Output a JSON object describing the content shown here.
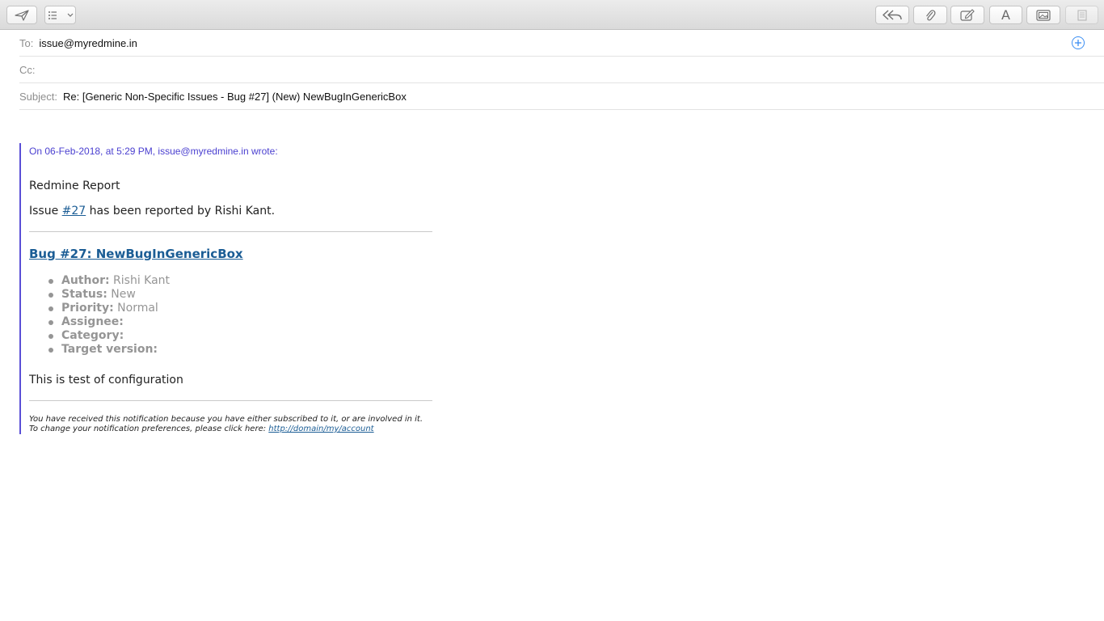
{
  "toolbar": {
    "left_buttons": [
      {
        "name": "send-button",
        "icon": "paper-plane-icon"
      },
      {
        "name": "header-fields-button",
        "icon": "list-icon"
      }
    ],
    "right_buttons": [
      {
        "name": "reply-all-button",
        "icon": "reply-all-icon"
      },
      {
        "name": "attach-button",
        "icon": "paperclip-icon"
      },
      {
        "name": "markup-button",
        "icon": "pen-square-icon"
      },
      {
        "name": "format-button",
        "icon": "font-icon",
        "glyph": "A"
      },
      {
        "name": "photo-browser-button",
        "icon": "photo-icon"
      },
      {
        "name": "stationery-button",
        "icon": "stationery-icon"
      }
    ]
  },
  "headers": {
    "to_label": "To:",
    "to_value": "issue@myredmine.in",
    "cc_label": "Cc:",
    "cc_value": "",
    "subject_label": "Subject:",
    "subject_value": "Re: [Generic Non-Specific Issues - Bug #27] (New) NewBugInGenericBox"
  },
  "quote": {
    "header": "On 06-Feb-2018, at 5:29 PM, issue@myredmine.in wrote:",
    "report_title": "Redmine Report",
    "issue_prefix": "Issue ",
    "issue_link": "#27",
    "issue_suffix": " has been reported by Rishi Kant.",
    "bug_title": "Bug #27: NewBugInGenericBox",
    "attributes": [
      {
        "label": "Author:",
        "value": " Rishi Kant"
      },
      {
        "label": "Status:",
        "value": " New"
      },
      {
        "label": "Priority:",
        "value": " Normal"
      },
      {
        "label": "Assignee:",
        "value": ""
      },
      {
        "label": "Category:",
        "value": ""
      },
      {
        "label": "Target version:",
        "value": ""
      }
    ],
    "description": "This is test of configuration",
    "footer_line1": "You have received this notification because you have either subscribed to it, or are involved in it.",
    "footer_line2_prefix": "To change your notification preferences, please click here: ",
    "footer_link": "http://domain/my/account"
  },
  "colors": {
    "quote_bar": "#5a4fd6",
    "quote_header": "#4a3fd0",
    "link": "#1b5d95",
    "plus_icon": "#3b8ef3"
  }
}
